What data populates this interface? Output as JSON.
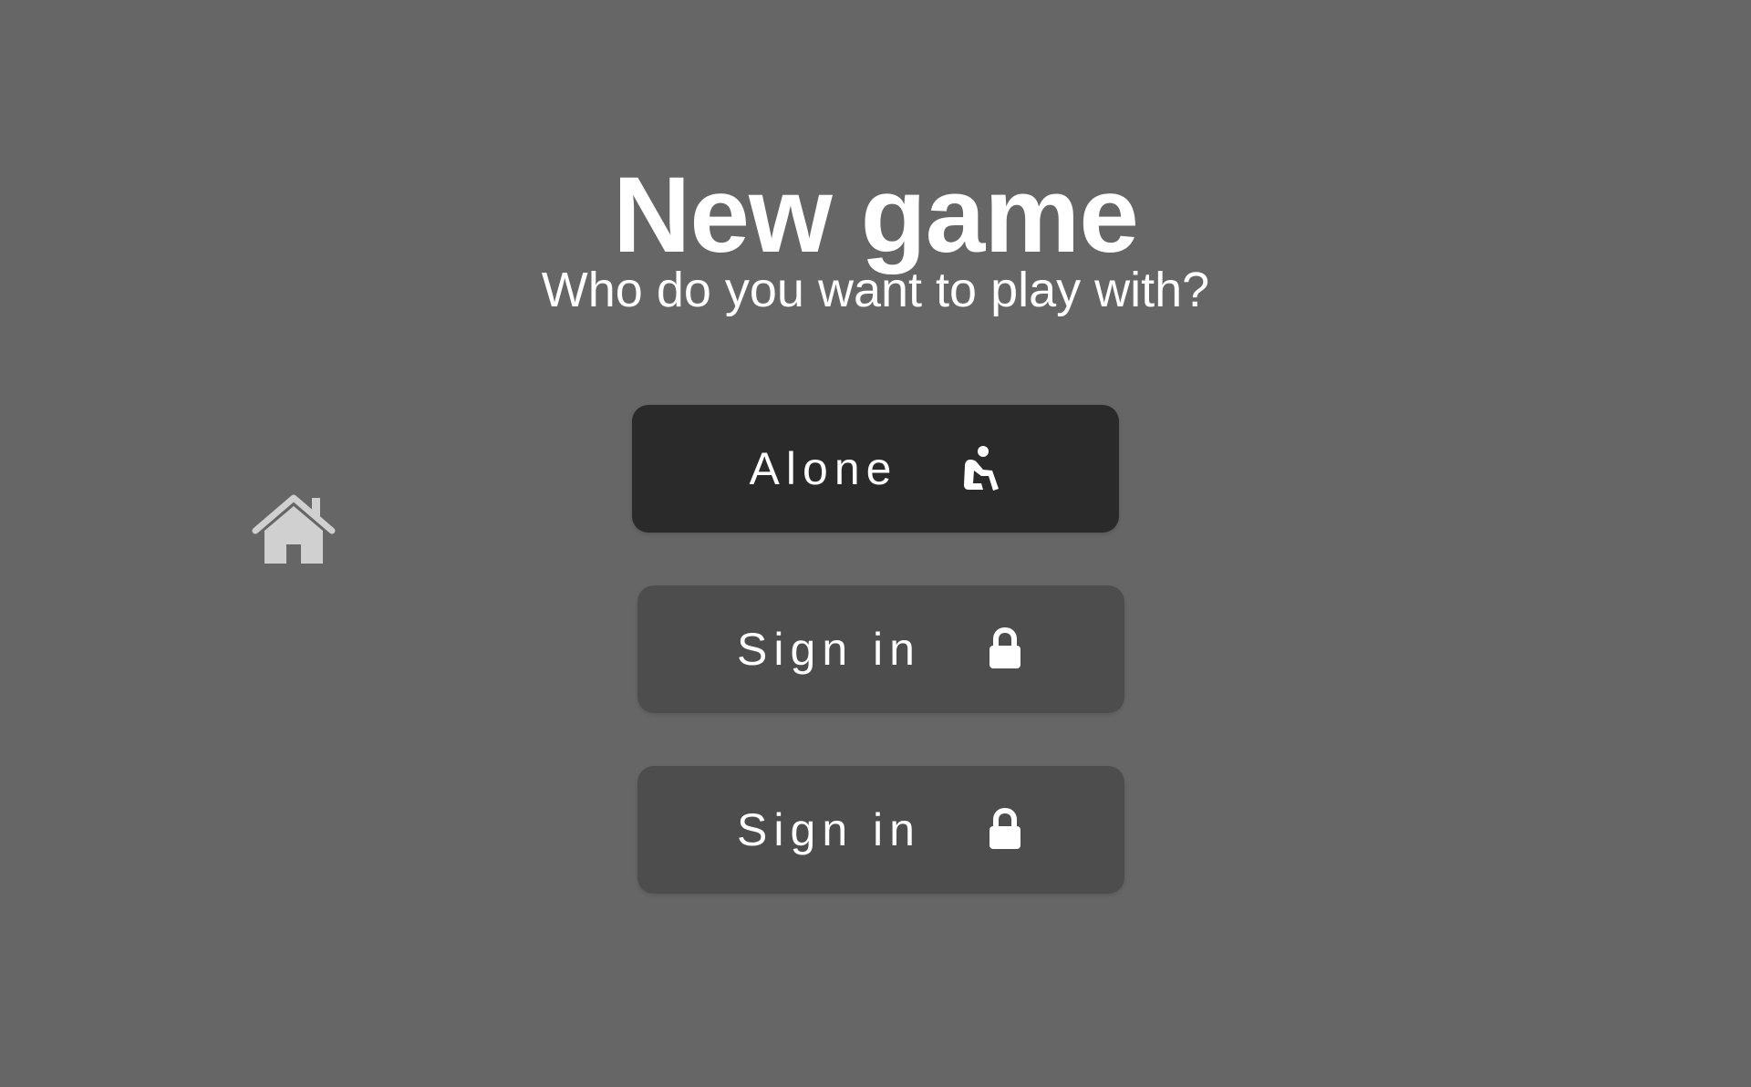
{
  "page": {
    "title": "New game",
    "subtitle": "Who do you want to play with?"
  },
  "nav": {
    "home_icon": "home-icon"
  },
  "options": [
    {
      "label": "Alone",
      "icon": "person-sitting-icon",
      "style": "primary"
    },
    {
      "label": "Sign in",
      "icon": "lock-icon",
      "style": "secondary"
    },
    {
      "label": "Sign in",
      "icon": "lock-icon",
      "style": "secondary"
    }
  ],
  "colors": {
    "background": "#666666",
    "primary_button": "#2a2a2a",
    "secondary_button": "#4d4d4d",
    "text": "#ffffff",
    "home_icon": "#d0d0d0"
  }
}
